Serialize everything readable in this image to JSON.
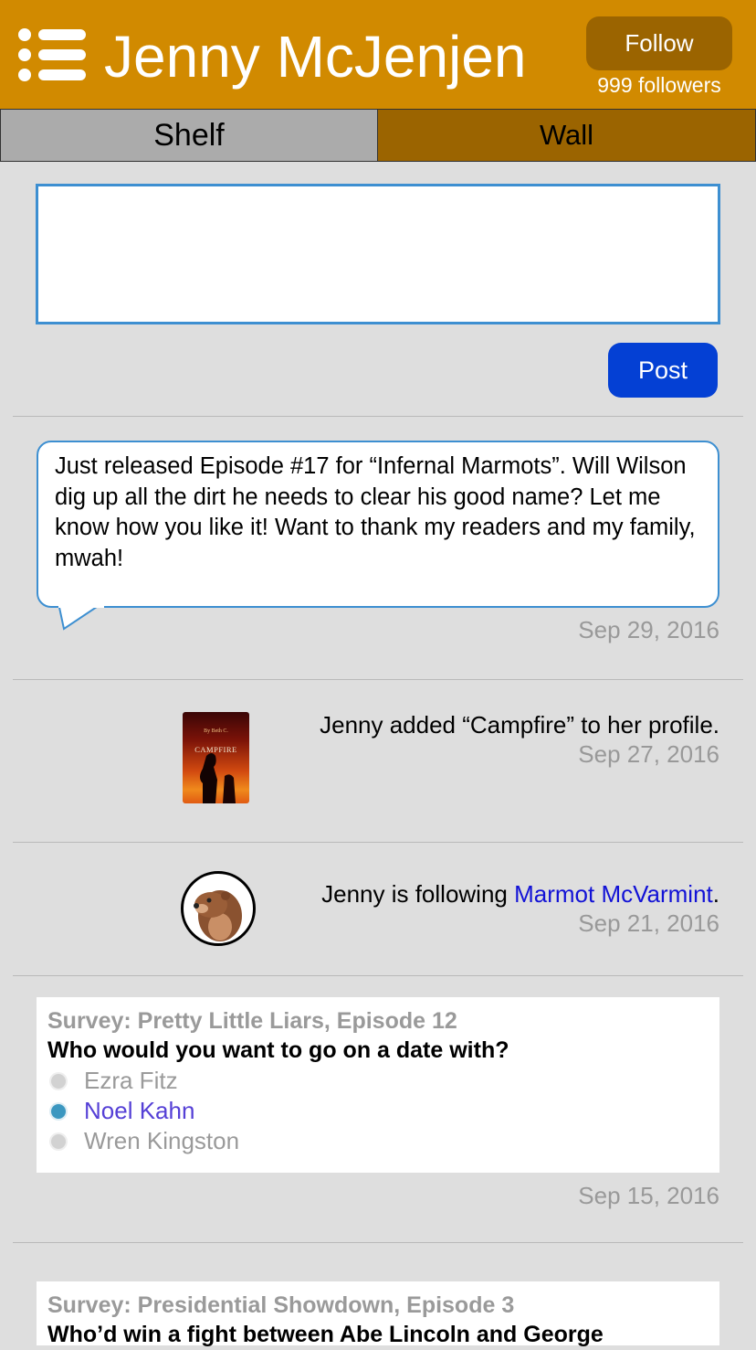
{
  "header": {
    "title": "Jenny McJenjen",
    "follow_label": "Follow",
    "followers": "999 followers",
    "menu_icon": "hamburger-menu-icon",
    "bg_color": "#d18a00"
  },
  "tabs": [
    {
      "label": "Shelf",
      "selected": true
    },
    {
      "label": "Wall",
      "selected": false
    }
  ],
  "compose": {
    "value": "",
    "post_label": "Post"
  },
  "feed": {
    "post": {
      "text": "Just released Episode #17 for “Infernal Marmots”.  Will Wilson dig up all the dirt he needs to clear his good name?  Let me know how you like it!  Want to thank my readers and my family, mwah!",
      "date": "Sep 29, 2016"
    },
    "added": {
      "text": "Jenny added “Campfire” to her profile.",
      "date": "Sep 27, 2016",
      "cover_author": "By Beth C.",
      "cover_title": "CAMPFIRE"
    },
    "following": {
      "prefix": "Jenny is following ",
      "link": "Marmot McVarmint",
      "suffix": ".",
      "date": "Sep 21, 2016"
    },
    "survey1": {
      "label": "Survey: Pretty Little Liars, Episode 12",
      "question": "Who would you want to go on a date with?",
      "options": [
        "Ezra Fitz",
        "Noel Kahn",
        "Wren Kingston"
      ],
      "selected_index": 1,
      "date": "Sep 15, 2016"
    },
    "survey2": {
      "label": "Survey: Presidential Showdown, Episode 3",
      "question": "Who’d win a fight between Abe Lincoln and George"
    }
  }
}
